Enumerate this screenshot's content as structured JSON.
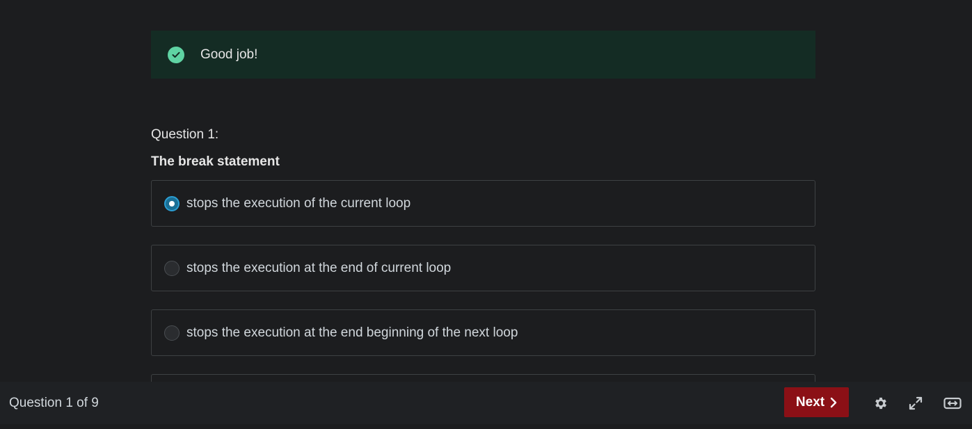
{
  "feedback": {
    "message": "Good job!"
  },
  "question": {
    "number_label": "Question 1:",
    "prompt": "The break statement",
    "answers": [
      {
        "label": "stops the execution of the current loop",
        "selected": true
      },
      {
        "label": "stops the execution at the end of current loop",
        "selected": false
      },
      {
        "label": "stops the execution at the end beginning of the next loop",
        "selected": false
      }
    ]
  },
  "footer": {
    "progress": "Question 1 of 9",
    "next_label": "Next",
    "icons": [
      "settings-icon",
      "expand-icon",
      "expand-width-icon"
    ]
  },
  "colors": {
    "background": "#1c1d1f",
    "success_bg": "#142c24",
    "success_icon": "#5fd3a3",
    "radio_selected": "#1a6f95",
    "next_button": "#8b1016"
  }
}
